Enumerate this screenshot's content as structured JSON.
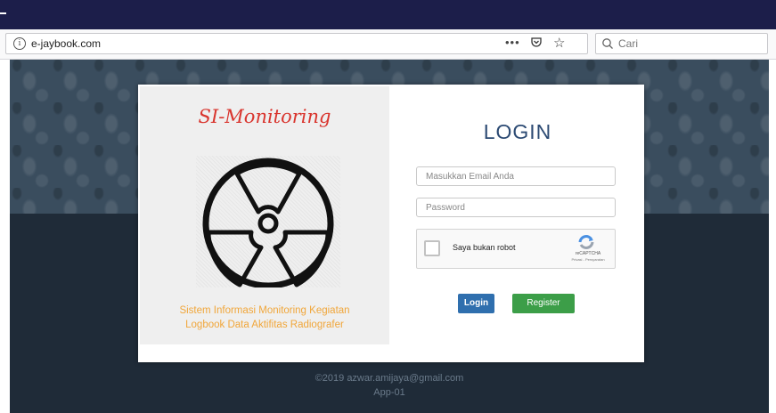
{
  "browser": {
    "url": "e-jaybook.com",
    "more_label": "•••",
    "search_placeholder": "Cari",
    "icons": [
      "info-icon",
      "pocket-icon",
      "star-icon",
      "search-icon"
    ]
  },
  "left": {
    "brand": "SI-Monitoring",
    "desc_line1": "Sistem Informasi Monitoring Kegiatan",
    "desc_line2": "Logbook Data Aktifitas Radiografer",
    "icon": "radiation-icon"
  },
  "form": {
    "title": "LOGIN",
    "email_placeholder": "Masukkan Email Anda",
    "password_placeholder": "Password",
    "captcha_label": "Saya bukan robot",
    "captcha_brand": "reCAPTCHA",
    "captcha_sub": "Privasi - Persyaratan",
    "login_button": "Login",
    "register_button": "Register"
  },
  "footer": {
    "copyright": "©2019 azwar.amijaya@gmail.com",
    "version": "App-01"
  },
  "colors": {
    "accent": "#2c4a73",
    "brand": "#d9352e",
    "login_button": "#2f6fae",
    "register_button": "#3c9e48",
    "desc_text": "#f0a63a"
  }
}
